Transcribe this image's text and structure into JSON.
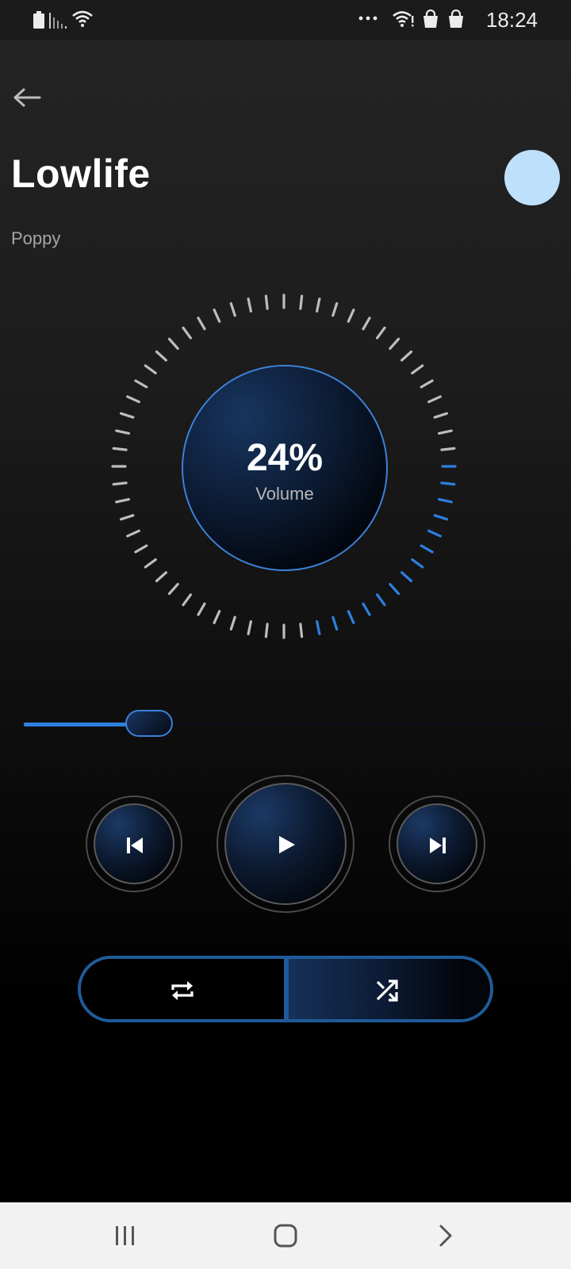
{
  "status_bar": {
    "time": "18:24",
    "left_icons": [
      "battery-icon",
      "signal-icon",
      "wifi-icon"
    ],
    "right_icons": [
      "more-icon",
      "wifi-icon",
      "shopping-bag-icon",
      "shopping-bag-icon"
    ]
  },
  "song": {
    "title": "Lowlife",
    "artist": "Poppy"
  },
  "volume": {
    "value_text": "24%",
    "label": "Volume",
    "level": 0.24
  },
  "seek": {
    "progress": 0.24
  },
  "controls": {
    "previous": "previous-icon",
    "play": "play-icon",
    "next": "next-icon",
    "repeat": "repeat-icon",
    "shuffle": "shuffle-icon",
    "shuffle_active": true
  },
  "colors": {
    "accent": "#2d7fe0",
    "accent_border": "#3d80d8",
    "tick_inactive": "#bdbdbd",
    "avatar": "#bfe0fb",
    "toggle_border": "#1f5b98"
  },
  "nav_bar": {
    "buttons": [
      "recent-apps-icon",
      "home-icon",
      "back-icon"
    ]
  }
}
